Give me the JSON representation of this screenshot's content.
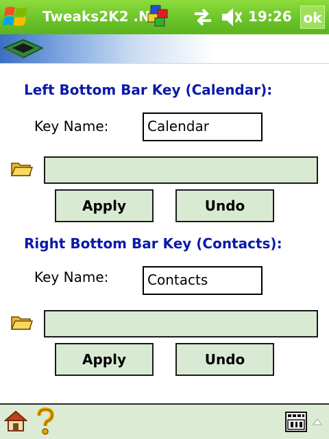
{
  "titlebar": {
    "title": "Tweaks2K2 .N",
    "time": "19:26",
    "ok_label": "ok"
  },
  "sections": [
    {
      "heading": "Left Bottom Bar Key (Calendar):",
      "key_name_label": "Key Name:",
      "key_name_value": "Calendar",
      "path_value": "",
      "apply_label": "Apply",
      "undo_label": "Undo"
    },
    {
      "heading": "Right Bottom Bar Key (Contacts):",
      "key_name_label": "Key Name:",
      "key_name_value": "Contacts",
      "path_value": "",
      "apply_label": "Apply",
      "undo_label": "Undo"
    }
  ],
  "icons": {
    "start": "windows-logo-icon",
    "app": "tweaks-app-icon",
    "sync": "sync-icon",
    "volume": "volume-muted-icon",
    "banner": "chip-icon",
    "folder": "folder-icon",
    "home": "home-icon",
    "help": "help-icon",
    "sip": "keyboard-icon"
  },
  "colors": {
    "titlebar": "#6cc42a",
    "heading": "#0a1aa8",
    "control_fill": "#d8ead2",
    "bottombar": "#dcecd4"
  }
}
